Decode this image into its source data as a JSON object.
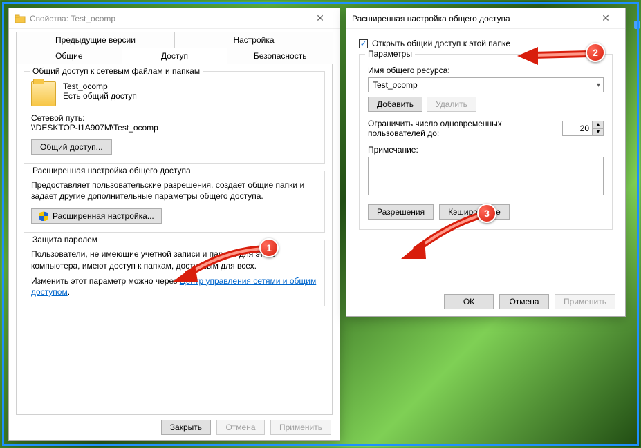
{
  "left_window": {
    "title": "Свойства: Test_ocomp",
    "tabs_row1": [
      "Предыдущие версии",
      "Настройка"
    ],
    "tabs_row2": [
      "Общие",
      "Доступ",
      "Безопасность"
    ],
    "active_tab": "Доступ",
    "group1": {
      "title": "Общий доступ к сетевым файлам и папкам",
      "folder_name": "Test_ocomp",
      "share_status": "Есть общий доступ",
      "path_label": "Сетевой путь:",
      "path_value": "\\\\DESKTOP-I1A907M\\Test_ocomp",
      "share_btn": "Общий доступ..."
    },
    "group2": {
      "title": "Расширенная настройка общего доступа",
      "desc": "Предоставляет пользовательские разрешения, создает общие папки и задает другие дополнительные параметры общего доступа.",
      "adv_btn": "Расширенная настройка..."
    },
    "group3": {
      "title": "Защита паролем",
      "line1": "Пользователи, не имеющие учетной записи и пароля для этого компьютера, имеют доступ к папкам, доступным для всех.",
      "line2_prefix": "Изменить этот параметр можно через ",
      "link": "Центр управления сетями и общим доступом"
    },
    "footer": {
      "close": "Закрыть",
      "cancel": "Отмена",
      "apply": "Применить"
    }
  },
  "right_window": {
    "title": "Расширенная настройка общего доступа",
    "checkbox_label": "Открыть общий доступ к этой папке",
    "checkbox_checked": true,
    "params_title": "Параметры",
    "share_name_label": "Имя общего ресурса:",
    "share_name_value": "Test_ocomp",
    "add_btn": "Добавить",
    "remove_btn": "Удалить",
    "limit_label": "Ограничить число одновременных пользователей до:",
    "limit_value": "20",
    "notes_label": "Примечание:",
    "notes_value": "",
    "permissions_btn": "Разрешения",
    "caching_btn": "Кэширование",
    "footer": {
      "ok": "ОК",
      "cancel": "Отмена",
      "apply": "Применить"
    }
  },
  "badges": {
    "b1": "1",
    "b2": "2",
    "b3": "3"
  }
}
